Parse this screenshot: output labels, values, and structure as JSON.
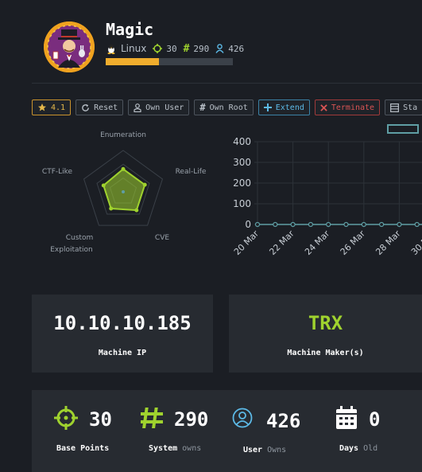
{
  "machine": {
    "name": "Magic",
    "os": "Linux",
    "points": "30",
    "system_owns": "290",
    "user_owns": "426",
    "progress": 0.42
  },
  "actions": {
    "rating": "4.1",
    "reset": "Reset",
    "own_user": "Own User",
    "own_root": "Own Root",
    "extend": "Extend",
    "terminate": "Terminate",
    "stats": "Sta"
  },
  "radar": {
    "axes": [
      "Enumeration",
      "Real-Life",
      "CVE",
      "Custom Exploitation",
      "CTF-Like"
    ],
    "axis_labels": {
      "enumeration": "Enumeration",
      "real_life": "Real-Life",
      "cve": "CVE",
      "custom": "Custom",
      "exploitation": "Exploitation",
      "ctf_like": "CTF-Like"
    },
    "values": [
      0.55,
      0.55,
      0.55,
      0.5,
      0.5
    ],
    "max": 1
  },
  "chart_data": {
    "type": "line",
    "x": [
      "20 Mar",
      "21 Mar",
      "22 Mar",
      "23 Mar",
      "24 Mar",
      "25 Mar",
      "26 Mar",
      "27 Mar",
      "28 Mar",
      "29 Mar",
      "30 Mar"
    ],
    "tick_labels": [
      "20 Mar",
      "22 Mar",
      "24 Mar",
      "26 Mar",
      "28 Mar",
      "30 Mar"
    ],
    "series": [
      {
        "values": [
          0,
          0,
          0,
          0,
          0,
          0,
          0,
          0,
          0,
          0,
          0
        ]
      }
    ],
    "ylim": [
      0,
      400
    ],
    "yticks": [
      0,
      100,
      200,
      300,
      400
    ],
    "grid": true,
    "line_color": "#5f9ea4"
  },
  "cards": {
    "ip_value": "10.10.10.185",
    "ip_label": "Machine IP",
    "maker_value": "TRX",
    "maker_label": "Machine Maker(s)"
  },
  "stats": {
    "base_points_value": "30",
    "base_points_label": "Base Points",
    "system_value": "290",
    "system_label": "System",
    "system_sub": "owns",
    "user_value": "426",
    "user_label": "User",
    "user_sub": "Owns",
    "days_value": "0",
    "days_label": "Days",
    "days_sub": "Old"
  },
  "colors": {
    "accent": "#9fd22e",
    "progress": "#f0ad2d",
    "user_icon": "#5cb9e6",
    "background": "#1b1e24",
    "card": "#272b31"
  }
}
